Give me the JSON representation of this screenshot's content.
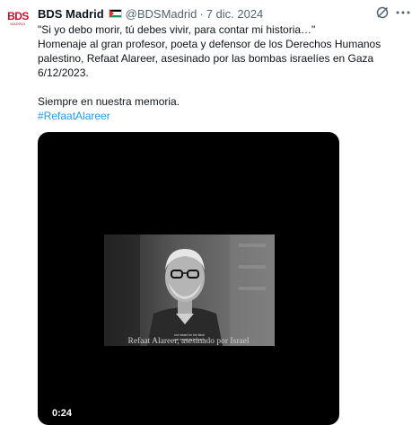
{
  "tweet": {
    "author": {
      "display_name": "BDS Madrid",
      "handle": "@BDSMadrid",
      "avatar_text": "BDS",
      "avatar_subtext": "MADRID",
      "flag_icon": "palestine-flag-icon"
    },
    "separator": "·",
    "date": "7 dic. 2024",
    "icons": {
      "grok": "grok-icon",
      "more": "more-icon"
    },
    "lines": [
      "\"Si yo debo morir, tú debes vivir, para contar mi historia…\"",
      "Homenaje al gran profesor, poeta y defensor de los Derechos Humanos",
      "palestino, Refaat Alareer, asesinado por las bombas israelíes en Gaza",
      "6/12/2023."
    ],
    "closing_line": "Siempre en nuestra memoria.",
    "hashtag": "#RefaatAlareer",
    "media": {
      "subtitle_small_1": "not meant for the flash",
      "subtitle_small_2": "not meant for beneath",
      "caption": "Refaat Alareer, asesinado por Israel",
      "duration": "0:24"
    }
  }
}
